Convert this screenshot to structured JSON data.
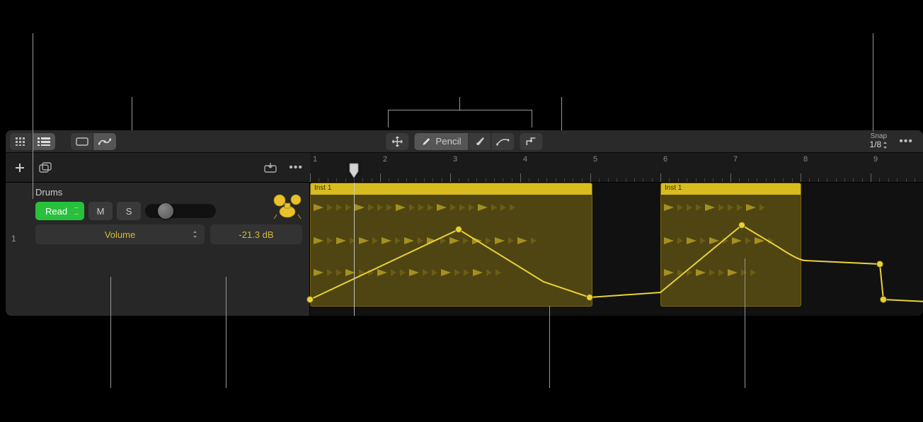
{
  "toolbar": {
    "pencil_label": "Pencil",
    "snap_label": "Snap",
    "snap_value": "1/8"
  },
  "track": {
    "number": "1",
    "name": "Drums",
    "automation_mode": "Read",
    "mute_label": "M",
    "solo_label": "S",
    "param_name": "Volume",
    "param_value": "-21.3 dB"
  },
  "ruler": {
    "bars": [
      "1",
      "2",
      "3",
      "4",
      "5",
      "6",
      "7",
      "8",
      "9"
    ]
  },
  "regions": [
    {
      "name": "Inst 1"
    },
    {
      "name": "Inst 1"
    }
  ]
}
